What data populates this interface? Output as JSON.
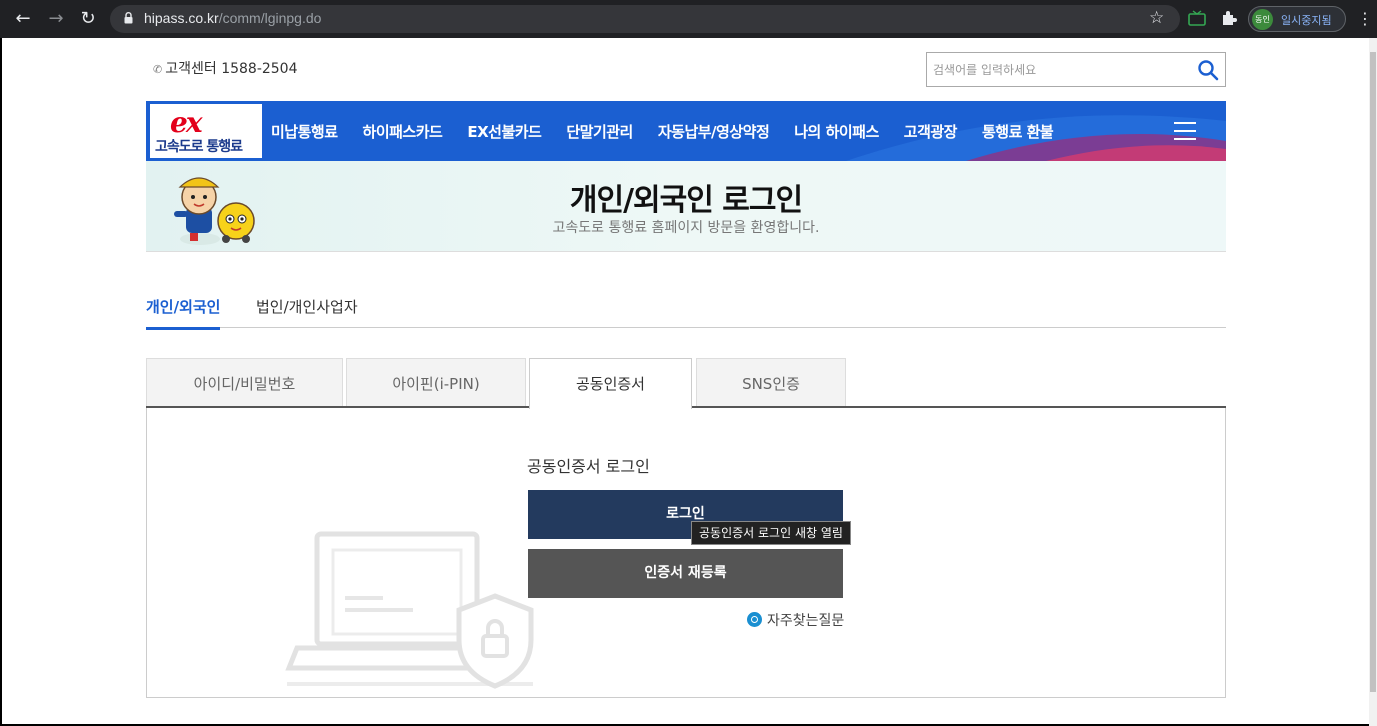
{
  "browser": {
    "url_host": "hipass.co.kr",
    "url_path": "/comm/lginpg.do",
    "profile_avatar": "동인",
    "profile_label": "일시중지됨"
  },
  "top": {
    "customer_center": "고객센터 1588-2504",
    "search_placeholder": "검색어를 입력하세요"
  },
  "logo": {
    "mark": "ex",
    "text": "고속도로 통행료"
  },
  "menu": [
    "미납통행료",
    "하이패스카드",
    "EX선불카드",
    "단말기관리",
    "자동납부/영상약정",
    "나의 하이패스",
    "고객광장",
    "통행료 환불"
  ],
  "banner": {
    "title": "개인/외국인 로그인",
    "subtitle": "고속도로 통행료 홈페이지 방문을 환영합니다."
  },
  "member_tabs": [
    "개인/외국인",
    "법인/개인사업자"
  ],
  "login_tabs": [
    "아이디/비밀번호",
    "아이핀(i-PIN)",
    "공동인증서",
    "SNS인증"
  ],
  "cert": {
    "title": "공동인증서 로그인",
    "login_button": "로그인",
    "tooltip": "공동인증서 로그인 새창 열림",
    "reregister_button": "인증서 재등록",
    "faq_link": "자주찾는질문"
  },
  "colors": {
    "nav_blue": "#1b5fd1",
    "login_button": "#233a5e",
    "reregister_button": "#555555",
    "active_tab_text": "#1b5fd1"
  }
}
